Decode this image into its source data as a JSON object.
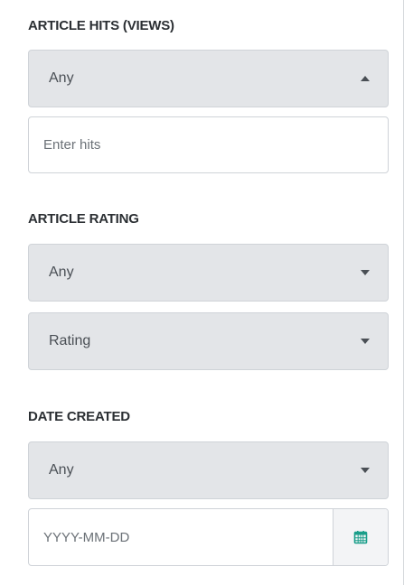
{
  "hits": {
    "label": "ARTICLE HITS (VIEWS)",
    "operator": "Any",
    "operator_open": true,
    "input_placeholder": "Enter hits",
    "input_value": ""
  },
  "rating": {
    "label": "ARTICLE RATING",
    "operator": "Any",
    "value": "Rating"
  },
  "date_created": {
    "label": "DATE CREATED",
    "operator": "Any",
    "date_placeholder": "YYYY-MM-DD",
    "date_value": "",
    "calendar_icon": "calendar-icon"
  },
  "colors": {
    "select_bg": "#e3e5e8",
    "border": "#cfd3d8",
    "calendar_accent": "#1a9e8a"
  }
}
